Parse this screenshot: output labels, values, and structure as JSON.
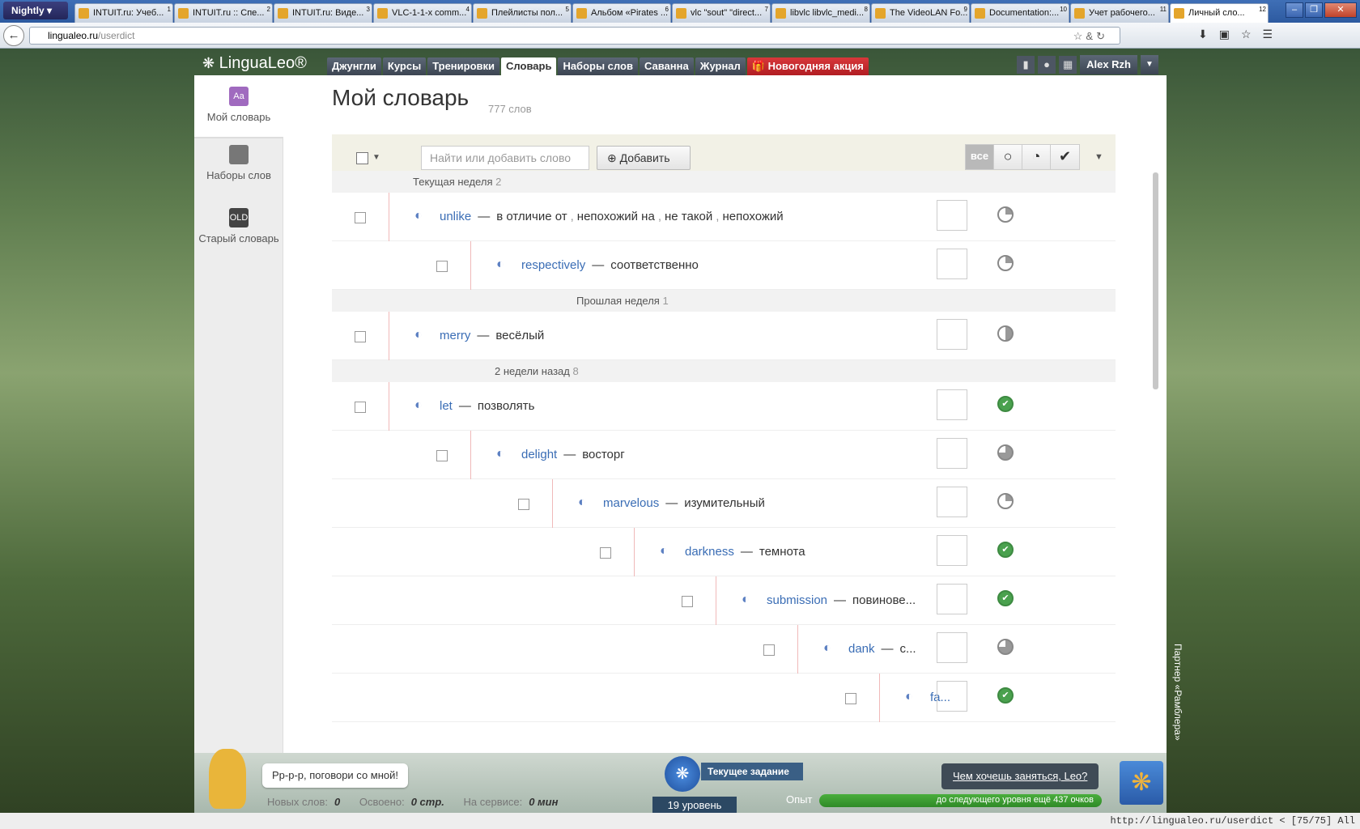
{
  "browser": {
    "menu_label": "Nightly",
    "tabs": [
      {
        "title": "INTUIT.ru: Учеб...",
        "num": "1"
      },
      {
        "title": "INTUIT.ru :: Спе...",
        "num": "2"
      },
      {
        "title": "INTUIT.ru: Виде...",
        "num": "3"
      },
      {
        "title": "VLC-1-1-x comm...",
        "num": "4"
      },
      {
        "title": "Плейлисты пол...",
        "num": "5"
      },
      {
        "title": "Альбом «Pirates ...",
        "num": "6"
      },
      {
        "title": "vlc \"sout\" \"direct...",
        "num": "7"
      },
      {
        "title": "libvlc libvlc_medi...",
        "num": "8"
      },
      {
        "title": "The VideoLAN Fo...",
        "num": "9"
      },
      {
        "title": "Documentation:...",
        "num": "10"
      },
      {
        "title": "Учет рабочего...",
        "num": "11"
      },
      {
        "title": "Личный сло...",
        "num": "12"
      }
    ],
    "url_host": "lingualeo.ru",
    "url_path": "/userdict",
    "status_url": "http://lingualeo.ru/userdict < [75/75] All"
  },
  "site": {
    "logo": "LinguaLeo®",
    "nav": [
      {
        "label": "Джунгли"
      },
      {
        "label": "Курсы"
      },
      {
        "label": "Тренировки"
      },
      {
        "label": "Словарь",
        "active": true
      },
      {
        "label": "Наборы слов"
      },
      {
        "label": "Саванна"
      },
      {
        "label": "Журнал"
      },
      {
        "label": "🎁 Новогодняя акция"
      }
    ],
    "username": "Alex Rzh"
  },
  "sidebar": {
    "items": [
      {
        "label": "Мой словарь",
        "icon": "Aa"
      },
      {
        "label": "Наборы слов"
      },
      {
        "label": "Старый словарь",
        "icon": "OLD"
      }
    ]
  },
  "main": {
    "title": "Мой словарь",
    "count": "777 слов",
    "search_placeholder": "Найти или добавить слово",
    "add_label": "Добавить",
    "filter_all": "все"
  },
  "groups": [
    {
      "label": "Текущая неделя",
      "count": "2"
    },
    {
      "label": "Прошлая неделя",
      "count": "1"
    },
    {
      "label": "2 недели назад",
      "count": "8"
    }
  ],
  "words": [
    {
      "en": "unlike",
      "tr": [
        "в отличие от",
        "непохожий на",
        "не такой",
        "непохожий"
      ],
      "progress": "q1"
    },
    {
      "en": "respectively",
      "tr": [
        "соответственно"
      ],
      "progress": "q1"
    },
    {
      "en": "merry",
      "tr": [
        "весёлый"
      ],
      "progress": "half"
    },
    {
      "en": "let",
      "tr": [
        "позволять"
      ],
      "progress": "done"
    },
    {
      "en": "delight",
      "tr": [
        "восторг"
      ],
      "progress": "q3"
    },
    {
      "en": "marvelous",
      "tr": [
        "изумительный"
      ],
      "progress": "q1"
    },
    {
      "en": "darkness",
      "tr": [
        "темнота"
      ],
      "progress": "done"
    },
    {
      "en": "submission",
      "tr": [
        "повинове..."
      ],
      "progress": "done"
    },
    {
      "en": "dank",
      "tr": [
        "с..."
      ],
      "progress": "q3"
    },
    {
      "en": "fa...",
      "tr": [],
      "progress": "done"
    }
  ],
  "partner": "Партнер «Рамблера»",
  "bottom": {
    "speech": "Рр-р-р, поговори со мной!",
    "new_words_label": "Новых слов:",
    "new_words": "0",
    "learned_label": "Освоено:",
    "learned": "0 стр.",
    "time_label": "На сервисе:",
    "time": "0 мин",
    "task_label": "Текущее задание",
    "level": "19 уровень",
    "xp_label": "Опыт",
    "xp_text": "до следующего уровня ещё 437 очков",
    "leo_question": "Чем хочешь заняться, Leo?"
  },
  "colors": {
    "accent": "#3a6db5",
    "promo": "#c4282c",
    "done": "#4aa14e"
  }
}
